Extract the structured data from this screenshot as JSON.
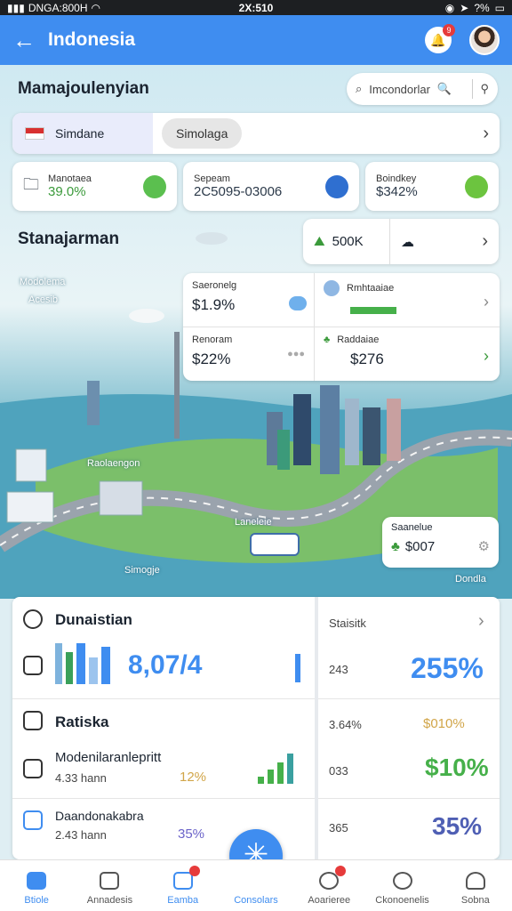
{
  "status_bar": {
    "carrier": "DNGA:800H",
    "time": "2X:510",
    "battery": "?%"
  },
  "app_bar": {
    "title": "Indonesia",
    "notif_count": "9"
  },
  "heading_main": "Mamajoulenyian",
  "search": {
    "placeholder": "Imcondorlar"
  },
  "tabs": {
    "active": "Simdane",
    "pill": "Simolaga"
  },
  "stats": [
    {
      "label": "Manotaea",
      "value": "39.0%"
    },
    {
      "label": "Sepeam",
      "value": "2C5095-03006"
    },
    {
      "label": "Boindkey",
      "value": "$342%"
    }
  ],
  "heading_section": "Stanajarman",
  "small_card": {
    "value": "500K"
  },
  "mid_card": {
    "a_label": "Saeronelg",
    "a_value": "$1.9%",
    "b_label": "Rmhtaaiae",
    "c_label": "Renoram",
    "c_value": "$22%",
    "d_label": "Raddaiae",
    "d_value": "$276"
  },
  "map_labels": {
    "top_left_1": "Modolema",
    "top_left_2": "Acesib",
    "mid": "Raolaengon",
    "bridge": "Laneleie",
    "bottom_left": "Simogje",
    "bottom_right": "Dondla"
  },
  "float_card": {
    "label": "Saanelue",
    "value": "$007"
  },
  "dashboard": {
    "row1_title": "Dunaistian",
    "row1_value": "8,07/4",
    "right_header": "Staisitk",
    "right1_left": "243",
    "right1_value": "255%",
    "row2_title": "Ratiska",
    "right2_left": "3.64%",
    "right2_value": "$010%",
    "row3_title": "Modenilaranlepritt",
    "row3_sub": "4.33 hann",
    "row3_pct": "12%",
    "right3_left": "033",
    "right3_value": "$10%",
    "row4_title": "Daandonakabra",
    "row4_sub": "2.43 hann",
    "row4_pct": "35%",
    "right4_left": "365",
    "right4_value": "35%"
  },
  "nav": [
    {
      "label": "Btiole"
    },
    {
      "label": "Annadesis"
    },
    {
      "label": "Eamba"
    },
    {
      "label": "Consolars"
    },
    {
      "label": "Aoarieree"
    },
    {
      "label": "Ckonoenelis"
    },
    {
      "label": "Sobna"
    }
  ],
  "colors": {
    "primary": "#3f8df0",
    "green": "#3b9a3b",
    "danger": "#e63b3b"
  }
}
